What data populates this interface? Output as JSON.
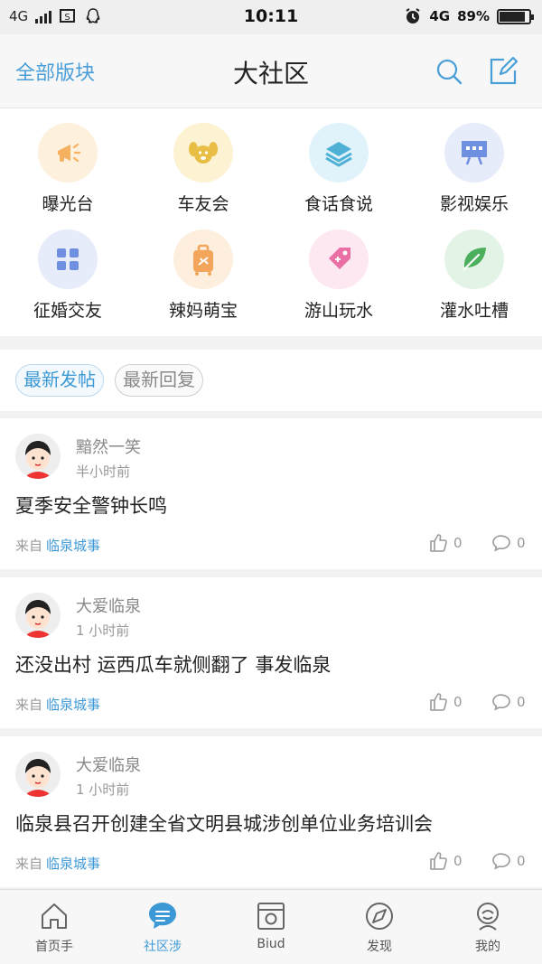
{
  "status_bar": {
    "network_left": "4G",
    "time": "10:11",
    "network_right": "4G",
    "battery": "89%",
    "battery_level": 0.89
  },
  "header": {
    "left_link": "全部版块",
    "title": "大社区",
    "search_icon": "search-icon",
    "edit_icon": "edit-icon"
  },
  "categories": [
    {
      "label": "曝光台",
      "icon": "megaphone-icon",
      "bg": "#fdf0dc",
      "color": "#f5b15f"
    },
    {
      "label": "车友会",
      "icon": "dog-icon",
      "bg": "#fdf2d2",
      "color": "#e9be45"
    },
    {
      "label": "食话食说",
      "icon": "layers-icon",
      "bg": "#e1f3fa",
      "color": "#4fb0d6"
    },
    {
      "label": "影视娱乐",
      "icon": "screen-icon",
      "bg": "#e6ecf9",
      "color": "#6f8fe0"
    },
    {
      "label": "征婚交友",
      "icon": "grid-icon",
      "bg": "#e6ecf9",
      "color": "#6f8fe0"
    },
    {
      "label": "辣妈萌宝",
      "icon": "luggage-icon",
      "bg": "#fdeedd",
      "color": "#f2a55b"
    },
    {
      "label": "游山玩水",
      "icon": "tag-icon",
      "bg": "#fde7f1",
      "color": "#e96fa4"
    },
    {
      "label": "灌水吐槽",
      "icon": "leaf-icon",
      "bg": "#e3f4e6",
      "color": "#4caf5e"
    }
  ],
  "filters": {
    "latest_posts": "最新发帖",
    "latest_replies": "最新回复"
  },
  "posts": [
    {
      "author": "黯然一笑",
      "time": "半小时前",
      "title": "夏季安全警钟长鸣",
      "from_label": "来自",
      "board": "临泉城事",
      "likes": "0",
      "comments": "0"
    },
    {
      "author": "大爱临泉",
      "time": "1 小时前",
      "title": "还没出村 运西瓜车就侧翻了 事发临泉",
      "from_label": "来自",
      "board": "临泉城事",
      "likes": "0",
      "comments": "0"
    },
    {
      "author": "大爱临泉",
      "time": "1 小时前",
      "title": "临泉县召开创建全省文明县城涉创单位业务培训会",
      "from_label": "来自",
      "board": "临泉城事",
      "likes": "0",
      "comments": "0"
    }
  ],
  "tabbar": [
    {
      "label": "首页手",
      "icon": "home-icon",
      "active": false
    },
    {
      "label": "社区涉",
      "icon": "chat-icon",
      "active": true
    },
    {
      "label": "Biud",
      "icon": "camera-icon",
      "active": false
    },
    {
      "label": "发现",
      "icon": "compass-icon",
      "active": false
    },
    {
      "label": "我的",
      "icon": "user-icon",
      "active": false
    }
  ],
  "colors": {
    "accent": "#3d98d6",
    "text": "#222222",
    "muted": "#999999"
  }
}
